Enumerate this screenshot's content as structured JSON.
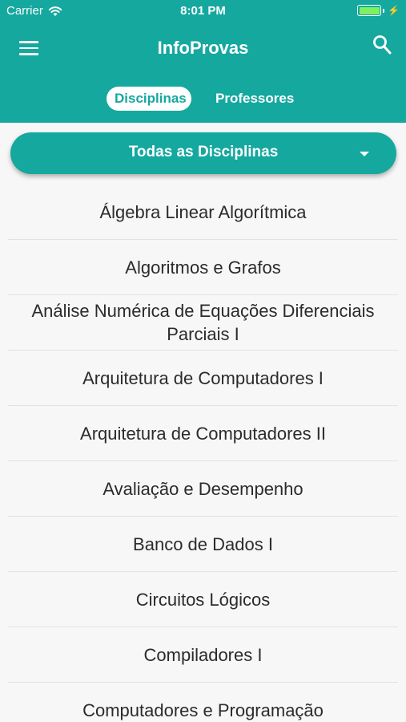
{
  "status_bar": {
    "carrier": "Carrier",
    "time": "8:01 PM",
    "battery_level": 1.0,
    "battery_color": "#7ff060"
  },
  "header": {
    "title": "InfoProvas",
    "menu_icon": "hamburger-menu-icon",
    "search_icon": "search-icon",
    "background": "#15a89f"
  },
  "tabs": [
    {
      "label": "Disciplinas",
      "selected": true
    },
    {
      "label": "Professores",
      "selected": false
    }
  ],
  "filter": {
    "selected": "Todas as Disciplinas",
    "icon": "chevron-down-icon"
  },
  "subjects": [
    "Álgebra Linear Algorítmica",
    "Algoritmos e Grafos",
    "Análise Numérica de Equações Diferenciais Parciais I",
    "Arquitetura de Computadores I",
    "Arquitetura de Computadores II",
    "Avaliação e Desempenho",
    "Banco de Dados I",
    "Circuitos Lógicos",
    "Compiladores I",
    "Computadores e Programação"
  ]
}
